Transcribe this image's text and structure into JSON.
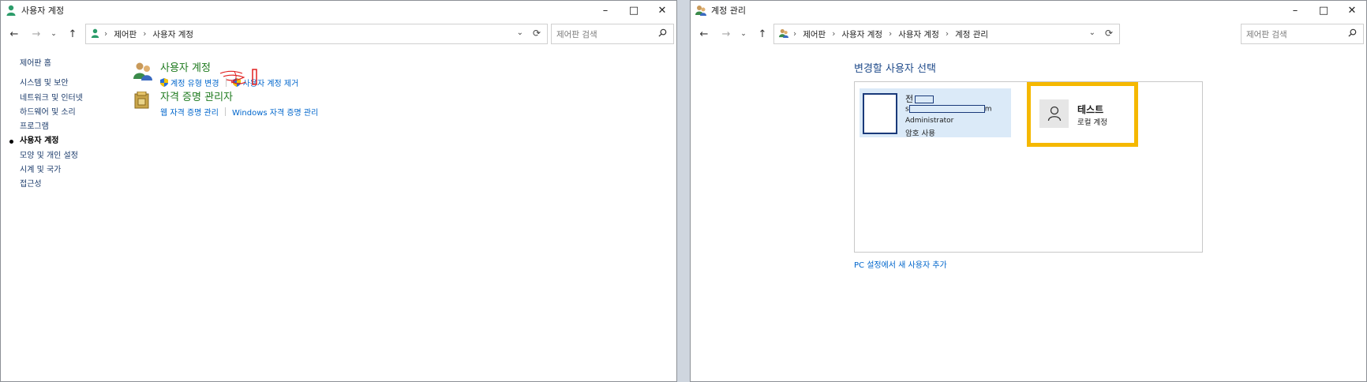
{
  "left_window": {
    "title": "사용자 계정",
    "breadcrumb": [
      "제어판",
      "사용자 계정"
    ],
    "search_placeholder": "제어판 검색",
    "sidebar": {
      "home": "제어판 홈",
      "items": [
        "시스템 및 보안",
        "네트워크 및 인터넷",
        "하드웨어 및 소리",
        "프로그램",
        "사용자 계정",
        "모양 및 개인 설정",
        "시계 및 국가",
        "접근성"
      ],
      "active": "사용자 계정"
    },
    "categories": [
      {
        "title": "사용자 계정",
        "links": [
          "계정 유형 변경",
          "사용자 계정 제거"
        ]
      },
      {
        "title": "자격 증명 관리자",
        "links": [
          "웹 자격 증명 관리",
          "Windows 자격 증명 관리"
        ]
      }
    ]
  },
  "right_window": {
    "title": "계정 관리",
    "breadcrumb": [
      "제어판",
      "사용자 계정",
      "사용자 계정",
      "계정 관리"
    ],
    "search_placeholder": "제어판 검색",
    "heading": "변경할 사용자 선택",
    "accounts": [
      {
        "name_prefix": "전",
        "email_prefix": "s",
        "email_suffix": "m",
        "role": "Administrator",
        "status": "암호 사용"
      },
      {
        "name": "테스트",
        "type": "로컬 계정"
      }
    ],
    "add_user_link": "PC 설정에서 새 사용자 추가"
  },
  "colors": {
    "highlight_border": "#f5b800",
    "link": "#0066cc",
    "category_title": "#1e7a1e",
    "heading": "#1e4a8a"
  }
}
